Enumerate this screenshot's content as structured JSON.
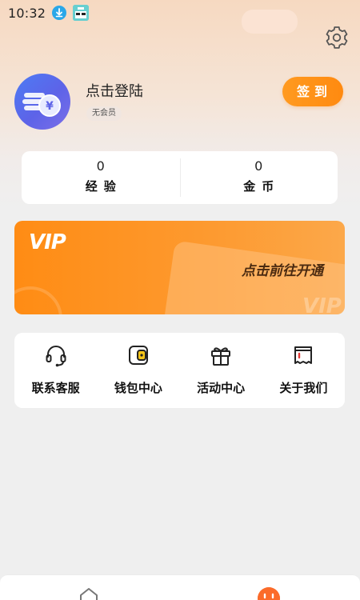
{
  "status_bar": {
    "time": "10:32"
  },
  "profile": {
    "username": "点击登陆",
    "member_level": "无会员",
    "checkin_label": "签到",
    "avatar_symbol": "¥"
  },
  "stats": [
    {
      "value": "0",
      "label": "经验"
    },
    {
      "value": "0",
      "label": "金币"
    }
  ],
  "vip": {
    "logo": "VIP",
    "cta": "点击前往开通",
    "watermark": "VIP"
  },
  "menu": [
    {
      "icon": "headset-icon",
      "label": "联系客服"
    },
    {
      "icon": "wallet-icon",
      "label": "钱包中心"
    },
    {
      "icon": "gift-icon",
      "label": "活动中心"
    },
    {
      "icon": "about-icon",
      "label": "关于我们"
    }
  ],
  "tabs": [
    {
      "icon": "home-icon",
      "active": false
    },
    {
      "icon": "mine-icon",
      "active": true
    }
  ],
  "colors": {
    "accent": "#ff8c14",
    "tab_active": "#fb6b2a",
    "avatar": "#5d63e8"
  }
}
